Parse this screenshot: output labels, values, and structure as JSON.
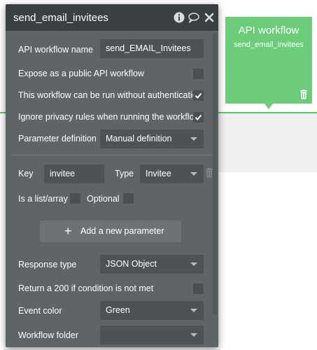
{
  "panel": {
    "title": "send_email_invitees",
    "icons": [
      "info-icon",
      "comment-icon",
      "close-icon"
    ]
  },
  "fields": {
    "workflow_name_label": "API workflow name",
    "workflow_name_value": "send_EMAIL_Invitees",
    "expose_label": "Expose as a public API workflow",
    "expose_checked": false,
    "no_auth_label": "This workflow can be run without authentication",
    "no_auth_checked": true,
    "ignore_privacy_label": "Ignore privacy rules when running the workflow",
    "ignore_privacy_checked": true,
    "param_def_label": "Parameter definition",
    "param_def_value": "Manual definition"
  },
  "parameter": {
    "key_label": "Key",
    "key_value": "invitee",
    "type_label": "Type",
    "type_value": "Invitee",
    "is_list_label": "Is a list/array",
    "is_list_checked": false,
    "optional_label": "Optional",
    "optional_checked": false
  },
  "add_parameter": {
    "plus": "+",
    "label": "Add a new parameter"
  },
  "response": {
    "response_type_label": "Response type",
    "response_type_value": "JSON Object",
    "return_200_label": "Return a 200 if condition is not met",
    "return_200_checked": false,
    "event_color_label": "Event color",
    "event_color_value": "Green",
    "folder_label": "Workflow folder",
    "folder_value": ""
  },
  "workflow_card": {
    "title": "API workflow",
    "subtitle": "send_email_invitees",
    "color": "#6dcc7a"
  },
  "colors": {
    "panel_bg": "#5f6466",
    "header_bg": "#3a3f42",
    "field_bg": "#4d5254",
    "accent_green": "#5cc66b"
  }
}
